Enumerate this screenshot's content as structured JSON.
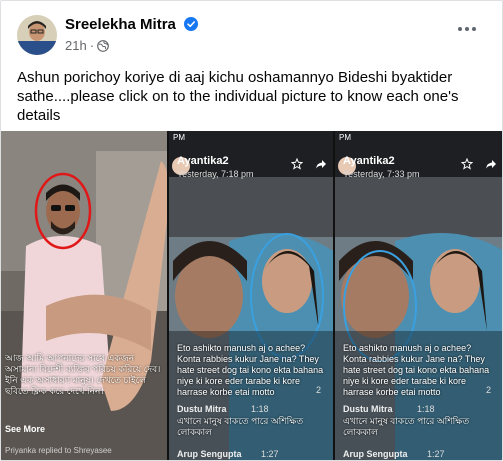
{
  "post": {
    "author": "Sreelekha Mitra",
    "time": "21h",
    "dot": "·",
    "text": "Ashun porichoy koriye di aaj kichu oshamannyo Bideshi byaktider sathe....please click on to the individual picture to know each one's details"
  },
  "tiles": [
    {
      "bengali_text": "আজ আমি আপনাদের সাথে একজন অসামান্য বিদেশী ব্যক্তির পরিচয় করিয়ে দেব। ইনি এক অসাধারণ মানুষ। দেখতে চাইলে ছবিতে ক্লিক করে দেখে নিন।",
      "see_more": "See More",
      "reply": "Priyanka replied to Shreyasee"
    },
    {
      "status_left": "PM",
      "name": "Ayantika2",
      "timestamp": "Yesterday, 7:18 pm",
      "caption": "Eto ashikto manush aj o achee? Konta rabbies kukur Jane na? They hate street dog tai kono ekta bahana niye ki kore eder tarabe ki kore harrase korbe etai motto",
      "comment_name": "Dustu Mitra",
      "comment_time": "1:18",
      "comment_text": "এখানে মানুষ বাকতে পারে অশিক্ষিত লোককাল",
      "footer_name": "Arup Sengupta",
      "footer_time": "1:27",
      "like_count": "2"
    },
    {
      "status_left": "PM",
      "name": "Ayantika2",
      "timestamp": "Yesterday, 7:33 pm",
      "caption": "Eto ashikto manush aj o achee? Konta rabbies kukur Jane na? They hate street dog tai kono ekta bahana niye ki kore eder tarabe ki kore harrase korbe etai motto",
      "comment_name": "Dustu Mitra",
      "comment_time": "1:18",
      "comment_text": "এখানে মানুষ বাকতে পারে অশিক্ষিত লোককাল",
      "footer_name": "Arup Sengupta",
      "footer_time": "1:27",
      "like_count": "2"
    }
  ]
}
